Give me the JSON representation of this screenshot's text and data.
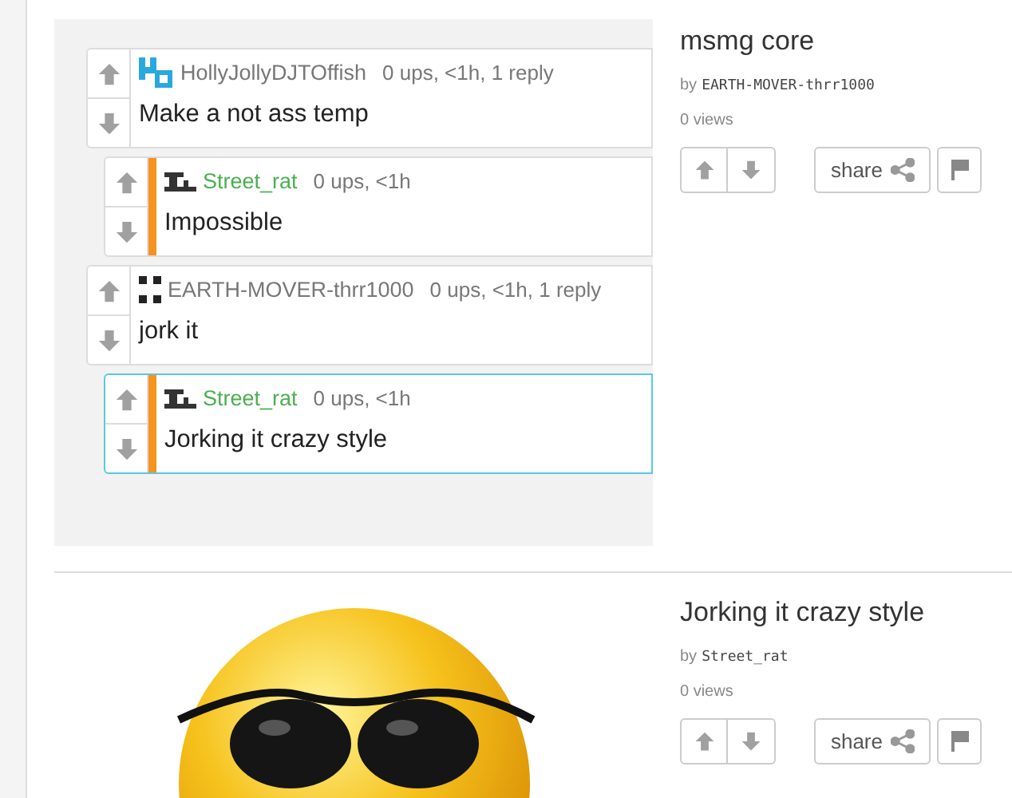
{
  "posts": [
    {
      "kind": "comments",
      "comments": [
        {
          "user": "HollyJollyDJTOffish",
          "kind": "blocks",
          "color": "#777777",
          "meta": "0 ups, <1h, 1 reply",
          "text": "Make a not ass temp",
          "highlighted": false,
          "children": [
            {
              "user": "Street_rat",
              "kind": "bricks",
              "color": "#4caf50",
              "meta": "0 ups, <1h",
              "text": "Impossible",
              "highlighted": false
            }
          ]
        },
        {
          "user": "EARTH-MOVER-thrr1000",
          "kind": "dots",
          "color": "#777777",
          "meta": "0 ups, <1h, 1 reply",
          "text": "jork it",
          "highlighted": false,
          "children": [
            {
              "user": "Street_rat",
              "kind": "bricks",
              "color": "#4caf50",
              "meta": "0 ups, <1h",
              "text": "Jorking it crazy style",
              "highlighted": true
            }
          ]
        }
      ],
      "title": "msmg core",
      "by": "by",
      "author": "EARTH-MOVER-thrr1000",
      "views": "0 views",
      "share": "share"
    },
    {
      "kind": "photo",
      "title": "Jorking it crazy style",
      "by": "by",
      "author": "Street_rat",
      "views": "0 views",
      "share": "share"
    }
  ]
}
